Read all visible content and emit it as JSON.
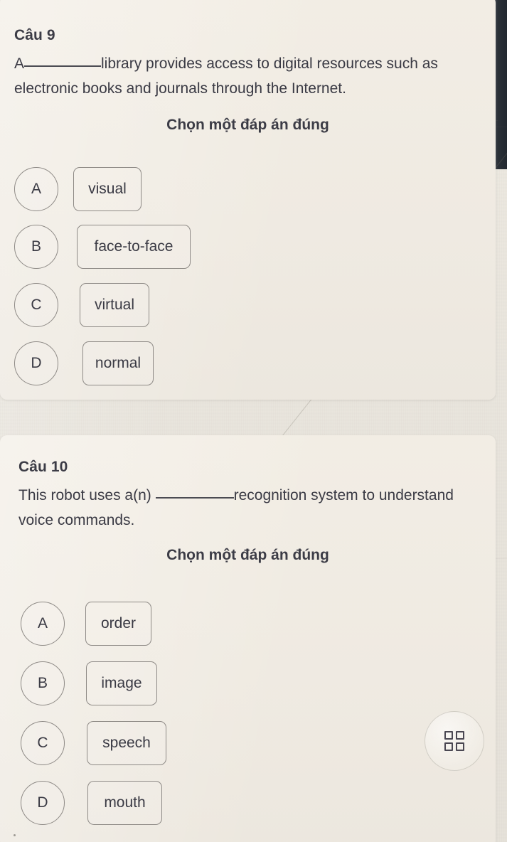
{
  "questions": [
    {
      "number_label": "Câu 9",
      "text_before_blank": "A",
      "text_after_blank": "library provides access to digital resources such as electronic books and journals through the Internet.",
      "choose_hint": "Chọn một đáp án đúng",
      "options": [
        {
          "letter": "A",
          "label": "visual"
        },
        {
          "letter": "B",
          "label": "face-to-face"
        },
        {
          "letter": "C",
          "label": "virtual"
        },
        {
          "letter": "D",
          "label": "normal"
        }
      ]
    },
    {
      "number_label": "Câu 10",
      "text_before_blank": "This robot uses a(n)",
      "text_after_blank": "recognition system to understand voice commands.",
      "choose_hint": "Chọn một đáp án đúng",
      "options": [
        {
          "letter": "A",
          "label": "order"
        },
        {
          "letter": "B",
          "label": "image"
        },
        {
          "letter": "C",
          "label": "speech"
        },
        {
          "letter": "D",
          "label": "mouth"
        }
      ]
    }
  ],
  "floating_button": {
    "icon": "grid-four-squares-icon"
  },
  "colors": {
    "page_background": "#e8e4dc",
    "card_background": "#f0ebe2",
    "text": "#3a3a44",
    "outline": "#8e8a86",
    "bezel": "#2b3138"
  }
}
